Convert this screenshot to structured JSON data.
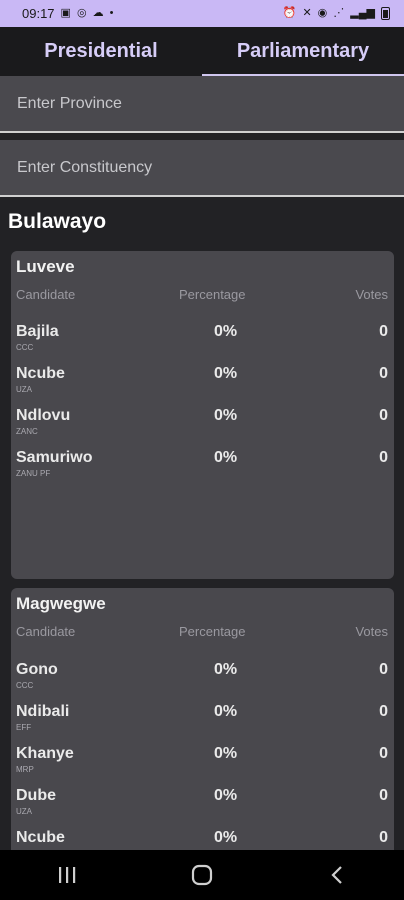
{
  "status": {
    "time": "09:17"
  },
  "tabs": [
    {
      "label": "Presidential"
    },
    {
      "label": "Parliamentary"
    }
  ],
  "search": {
    "province_placeholder": "Enter Province",
    "constituency_placeholder": "Enter Constituency"
  },
  "province": "Bulawayo",
  "table_headers": {
    "candidate": "Candidate",
    "percentage": "Percentage",
    "votes": "Votes"
  },
  "constituencies": [
    {
      "name": "Luveve",
      "candidates": [
        {
          "name": "Bajila",
          "party": "CCC",
          "percentage": "0%",
          "votes": "0"
        },
        {
          "name": "Ncube",
          "party": "UZA",
          "percentage": "0%",
          "votes": "0"
        },
        {
          "name": "Ndlovu",
          "party": "ZANC",
          "percentage": "0%",
          "votes": "0"
        },
        {
          "name": "Samuriwo",
          "party": "ZANU PF",
          "percentage": "0%",
          "votes": "0"
        }
      ]
    },
    {
      "name": "Magwegwe",
      "candidates": [
        {
          "name": "Gono",
          "party": "CCC",
          "percentage": "0%",
          "votes": "0"
        },
        {
          "name": "Ndibali",
          "party": "EFF",
          "percentage": "0%",
          "votes": "0"
        },
        {
          "name": "Khanye",
          "party": "MRP",
          "percentage": "0%",
          "votes": "0"
        },
        {
          "name": "Dube",
          "party": "UZA",
          "percentage": "0%",
          "votes": "0"
        },
        {
          "name": "Ncube",
          "party": "",
          "percentage": "0%",
          "votes": "0"
        }
      ]
    }
  ]
}
